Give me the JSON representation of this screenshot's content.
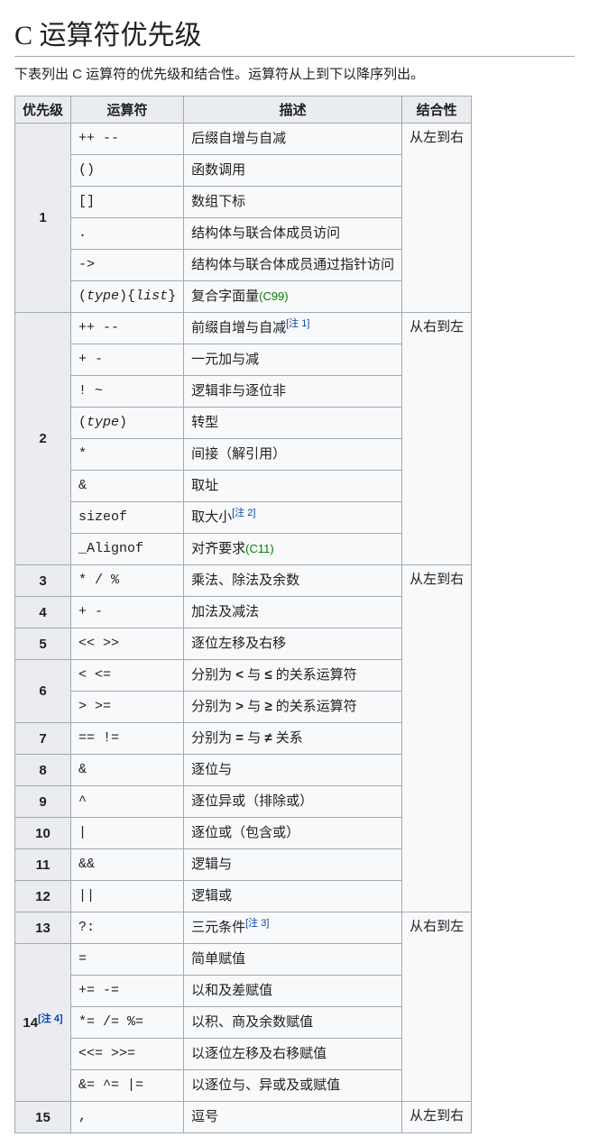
{
  "title": "C 运算符优先级",
  "intro": "下表列出 C 运算符的优先级和结合性。运算符从上到下以降序列出。",
  "headers": {
    "prec": "优先级",
    "op": "运算符",
    "desc": "描述",
    "assoc": "结合性"
  },
  "table": [
    {
      "prec": "1",
      "rows": [
        {
          "op_html": "++ --",
          "desc_html": "后缀自增与自减"
        },
        {
          "op_html": "()",
          "desc_html": "函数调用"
        },
        {
          "op_html": "[]",
          "desc_html": "数组下标"
        },
        {
          "op_html": ".",
          "desc_html": "结构体与联合体成员访问"
        },
        {
          "op_html": "-&gt;",
          "desc_html": "结构体与联合体成员通过指针访问"
        },
        {
          "op_html": "(<em>type</em>){<em>list</em>}",
          "desc_html": "复合字面量<span class=\"std\">(C99)</span>"
        }
      ],
      "assoc": "从左到右",
      "assoc_span": 1
    },
    {
      "prec": "2",
      "rows": [
        {
          "op_html": "++ --",
          "desc_html": "前缀自增与自减<sup class=\"note\"><a>[注 1]</a></sup>"
        },
        {
          "op_html": "+ -",
          "desc_html": "一元加与减"
        },
        {
          "op_html": "! ~",
          "desc_html": "逻辑非与逐位非"
        },
        {
          "op_html": "(<em>type</em>)",
          "desc_html": "转型"
        },
        {
          "op_html": "*",
          "desc_html": "间接（解引用）"
        },
        {
          "op_html": "&amp;",
          "desc_html": "取址"
        },
        {
          "op_html": "sizeof",
          "desc_html": "取大小<sup class=\"note\"><a>[注 2]</a></sup>"
        },
        {
          "op_html": "_Alignof",
          "desc_html": "对齐要求<span class=\"std\">(C11)</span>"
        }
      ],
      "assoc": "从右到左",
      "assoc_span": 1
    },
    {
      "prec": "3",
      "rows": [
        {
          "op_html": "* / %",
          "desc_html": "乘法、除法及余数"
        }
      ],
      "assoc": "从左到右",
      "assoc_span": 10
    },
    {
      "prec": "4",
      "rows": [
        {
          "op_html": "+ -",
          "desc_html": "加法及减法"
        }
      ]
    },
    {
      "prec": "5",
      "rows": [
        {
          "op_html": "&lt;&lt; &gt;&gt;",
          "desc_html": "逐位左移及右移"
        }
      ]
    },
    {
      "prec": "6",
      "rows": [
        {
          "op_html": "&lt; &lt;=",
          "desc_html": "分别为 <b>&lt;</b> 与 <b>≤</b> 的关系运算符"
        },
        {
          "op_html": "&gt; &gt;=",
          "desc_html": "分别为 <b>&gt;</b> 与 <b>≥</b> 的关系运算符"
        }
      ]
    },
    {
      "prec": "7",
      "rows": [
        {
          "op_html": "== !=",
          "desc_html": "分别为 <b>=</b> 与 <b>≠</b> 关系"
        }
      ]
    },
    {
      "prec": "8",
      "rows": [
        {
          "op_html": "&amp;",
          "desc_html": "逐位与"
        }
      ]
    },
    {
      "prec": "9",
      "rows": [
        {
          "op_html": "^",
          "desc_html": "逐位异或（排除或）"
        }
      ]
    },
    {
      "prec": "10",
      "rows": [
        {
          "op_html": "|",
          "desc_html": "逐位或（包含或）"
        }
      ]
    },
    {
      "prec": "11",
      "rows": [
        {
          "op_html": "&amp;&amp;",
          "desc_html": "逻辑与"
        }
      ]
    },
    {
      "prec": "12",
      "rows": [
        {
          "op_html": "||",
          "desc_html": "逻辑或"
        }
      ]
    },
    {
      "prec": "13",
      "rows": [
        {
          "op_html": "?:",
          "desc_html": "三元条件<sup class=\"note\"><a>[注 3]</a></sup>"
        }
      ],
      "assoc": "从右到左",
      "assoc_span": 2
    },
    {
      "prec_html": "14<sup class=\"note\"><a>[注 4]</a></sup>",
      "prec": "14",
      "rows": [
        {
          "op_html": "=",
          "desc_html": "简单赋值"
        },
        {
          "op_html": "+= -=",
          "desc_html": "以和及差赋值"
        },
        {
          "op_html": "*= /= %=",
          "desc_html": "以积、商及余数赋值"
        },
        {
          "op_html": "&lt;&lt;= &gt;&gt;=",
          "desc_html": "以逐位左移及右移赋值"
        },
        {
          "op_html": "&amp;= ^= |=",
          "desc_html": "以逐位与、异或及或赋值"
        }
      ]
    },
    {
      "prec": "15",
      "rows": [
        {
          "op_html": ",",
          "desc_html": "逗号"
        }
      ],
      "assoc": "从左到右",
      "assoc_span": 1
    }
  ]
}
